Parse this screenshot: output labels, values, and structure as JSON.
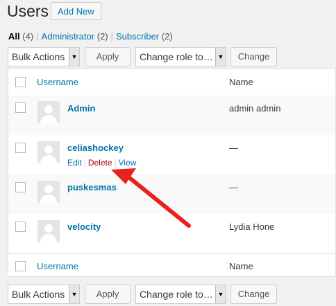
{
  "header": {
    "title": "Users",
    "add_new": "Add New"
  },
  "filters": {
    "all": "All",
    "all_count": "(4)",
    "administrator": "Administrator",
    "administrator_count": "(2)",
    "subscriber": "Subscriber",
    "subscriber_count": "(2)",
    "separator": "|"
  },
  "bulk": {
    "bulk_actions": "Bulk Actions",
    "apply": "Apply",
    "change_role": "Change role to…",
    "change": "Change",
    "arrow": "▼"
  },
  "table": {
    "col_username": "Username",
    "col_name": "Name",
    "rows": [
      {
        "username": "Admin",
        "name": "admin admin"
      },
      {
        "username": "celiashockey",
        "name": "—",
        "edit": "Edit",
        "delete": "Delete",
        "view": "View"
      },
      {
        "username": "puskesmas",
        "name": "—"
      },
      {
        "username": "velocity",
        "name": "Lydia Hone"
      }
    ]
  },
  "colors": {
    "link": "#0073aa",
    "delete": "#aa0000",
    "annotation_arrow": "#e8211f"
  }
}
